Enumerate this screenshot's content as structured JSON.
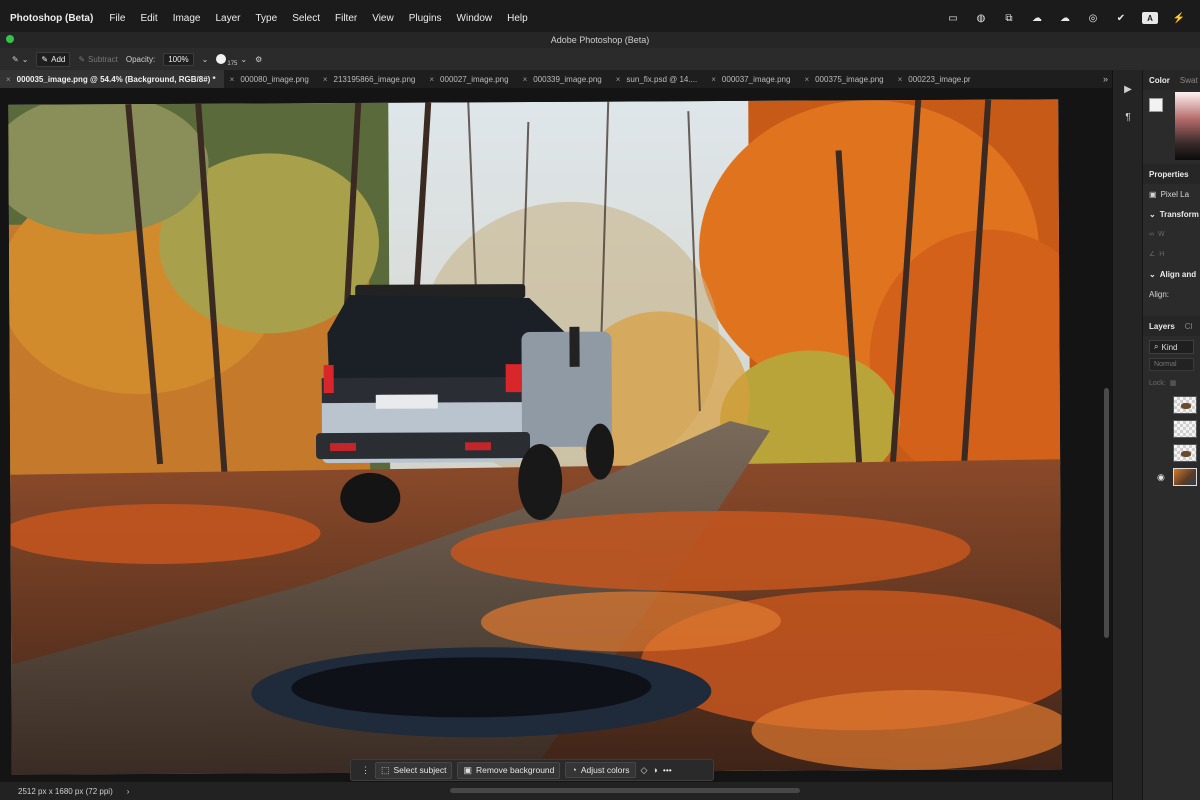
{
  "menubar": {
    "app_name": "Photoshop (Beta)",
    "items": [
      "File",
      "Edit",
      "Image",
      "Layer",
      "Type",
      "Select",
      "Filter",
      "View",
      "Plugins",
      "Window",
      "Help"
    ],
    "status_icons": [
      "display-icon",
      "globe-icon",
      "adobe-cc-icon",
      "cloud-icon",
      "creative-cloud-icon",
      "eye-icon",
      "checkmark-circle-icon",
      "input-source-icon",
      "battery-icon"
    ],
    "input_source_label": "A"
  },
  "window": {
    "title": "Adobe Photoshop (Beta)"
  },
  "options": {
    "add_label": "Add",
    "subtract_label": "Subtract",
    "opacity_label": "Opacity:",
    "opacity_value": "100%",
    "brush_size": "175"
  },
  "tabs": [
    {
      "label": "000035_image.png @ 54.4% (Background, RGB/8#) *",
      "active": true
    },
    {
      "label": "000080_image.png",
      "active": false
    },
    {
      "label": "213195866_image.png",
      "active": false
    },
    {
      "label": "000027_image.png",
      "active": false
    },
    {
      "label": "000339_image.png",
      "active": false
    },
    {
      "label": "sun_fix.psd @ 14....",
      "active": false
    },
    {
      "label": "000037_image.png",
      "active": false
    },
    {
      "label": "000375_image.png",
      "active": false
    },
    {
      "label": "000223_image.pr",
      "active": false
    }
  ],
  "tab_overflow": "»",
  "taskbar": {
    "select_subject": "Select subject",
    "remove_background": "Remove background",
    "adjust_colors": "Adjust colors",
    "more": "•••"
  },
  "status": {
    "dimensions": "2512 px x 1680 px (72 ppi)",
    "arrow": "›"
  },
  "panels": {
    "color_tab": "Color",
    "swatches_tab": "Swat",
    "properties_title": "Properties",
    "pixel_layer": "Pixel La",
    "transform": "Transform",
    "w_label": "W",
    "h_label": "H",
    "align_title": "Align and",
    "align_label": "Align:",
    "layers_tab": "Layers",
    "channels_tab": "Cl",
    "kind_label": "Kind",
    "blend_mode": "Normal",
    "lock_label": "Lock:"
  }
}
